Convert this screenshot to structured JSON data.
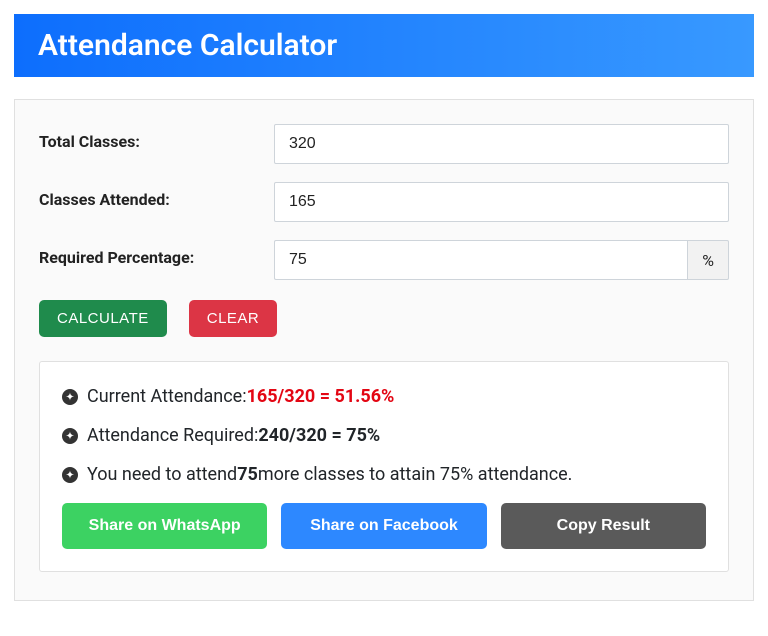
{
  "header": {
    "title": "Attendance Calculator"
  },
  "form": {
    "total_label": "Total Classes:",
    "total_value": "320",
    "attended_label": "Classes Attended:",
    "attended_value": "165",
    "required_label": "Required Percentage:",
    "required_value": "75",
    "percent_suffix": "%"
  },
  "buttons": {
    "calculate": "CALCULATE",
    "clear": "CLEAR"
  },
  "results": {
    "line1_label": "Current Attendance: ",
    "line1_value": "165/320 = 51.56%",
    "line2_label": "Attendance Required: ",
    "line2_value": "240/320 = 75%",
    "line3_pre": "You need to attend ",
    "line3_num": "75",
    "line3_post": " more classes to attain 75% attendance."
  },
  "share": {
    "whatsapp": "Share on WhatsApp",
    "facebook": "Share on Facebook",
    "copy": "Copy Result"
  }
}
